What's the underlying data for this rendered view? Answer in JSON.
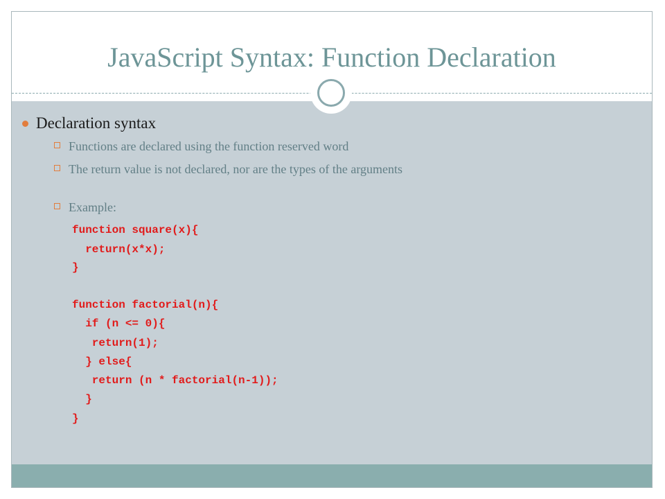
{
  "slide": {
    "title": "JavaScript Syntax: Function Declaration",
    "bullet": "Declaration syntax",
    "sub_bullets": [
      "Functions are declared using the function reserved word",
      "The return value is not declared, nor are the types of the arguments",
      "Example:"
    ],
    "code_lines": [
      "function square(x){",
      "  return(x*x);",
      "}",
      "function factorial(n){",
      "  if (n <= 0){",
      "   return(1);",
      "  } else{",
      "   return (n * factorial(n-1));",
      "  }",
      "}"
    ]
  },
  "colors": {
    "title": "#6d9597",
    "content_background": "#c6d0d6",
    "footer_band": "#8aaeae",
    "bullet_accent": "#e27d3d",
    "code": "#e11b1b"
  }
}
